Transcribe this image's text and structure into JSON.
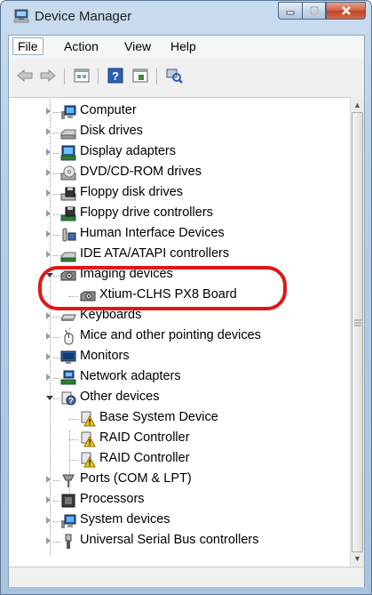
{
  "window": {
    "title": "Device Manager"
  },
  "menu": {
    "file": "File",
    "action": "Action",
    "view": "View",
    "help": "Help"
  },
  "toolbar": {
    "back_icon": "back-arrow-icon",
    "forward_icon": "forward-arrow-icon",
    "properties_icon": "properties-icon",
    "help_icon": "help-icon",
    "show_icon": "show-hide-icon",
    "scan_icon": "scan-hardware-icon"
  },
  "tree": {
    "items": [
      {
        "label": "Computer",
        "icon": "computer-icon"
      },
      {
        "label": "Disk drives",
        "icon": "disk-drive-icon"
      },
      {
        "label": "Display adapters",
        "icon": "display-adapter-icon"
      },
      {
        "label": "DVD/CD-ROM drives",
        "icon": "dvd-drive-icon"
      },
      {
        "label": "Floppy disk drives",
        "icon": "floppy-icon"
      },
      {
        "label": "Floppy drive controllers",
        "icon": "floppy-controller-icon"
      },
      {
        "label": "Human Interface Devices",
        "icon": "hid-icon"
      },
      {
        "label": "IDE ATA/ATAPI controllers",
        "icon": "ide-controller-icon"
      },
      {
        "label": "Imaging devices",
        "icon": "camera-icon"
      },
      {
        "label": "Xtium-CLHS PX8 Board",
        "icon": "camera-icon"
      },
      {
        "label": "Keyboards",
        "icon": "keyboard-icon"
      },
      {
        "label": "Mice and other pointing devices",
        "icon": "mouse-icon"
      },
      {
        "label": "Monitors",
        "icon": "monitor-icon"
      },
      {
        "label": "Network adapters",
        "icon": "network-adapter-icon"
      },
      {
        "label": "Other devices",
        "icon": "unknown-device-icon"
      },
      {
        "label": "Base System Device",
        "icon": "warning-device-icon"
      },
      {
        "label": "RAID Controller",
        "icon": "warning-device-icon"
      },
      {
        "label": "RAID Controller",
        "icon": "warning-device-icon"
      },
      {
        "label": "Ports (COM & LPT)",
        "icon": "port-icon"
      },
      {
        "label": "Processors",
        "icon": "processor-icon"
      },
      {
        "label": "System devices",
        "icon": "system-device-icon"
      },
      {
        "label": "Universal Serial Bus controllers",
        "icon": "usb-icon"
      }
    ]
  },
  "colors": {
    "highlight": "#e01616",
    "warning": "#f3c419"
  }
}
